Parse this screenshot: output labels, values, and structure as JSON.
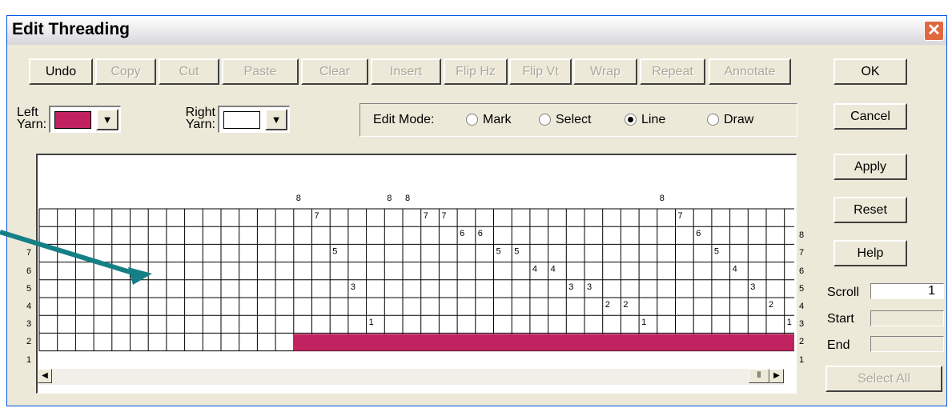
{
  "window": {
    "title": "Edit Threading",
    "close_glyph": "✕"
  },
  "toolbar": {
    "buttons": [
      {
        "label": "Undo",
        "enabled": true
      },
      {
        "label": "Copy",
        "enabled": false
      },
      {
        "label": "Cut",
        "enabled": false
      },
      {
        "label": "Paste",
        "enabled": false
      },
      {
        "label": "Clear",
        "enabled": false
      },
      {
        "label": "Insert",
        "enabled": false
      },
      {
        "label": "Flip Hz",
        "enabled": false
      },
      {
        "label": "Flip Vt",
        "enabled": false
      },
      {
        "label": "Wrap",
        "enabled": false
      },
      {
        "label": "Repeat",
        "enabled": false
      },
      {
        "label": "Annotate",
        "enabled": false
      }
    ]
  },
  "yarn": {
    "left_label_1": "Left",
    "left_label_2": "Yarn:",
    "left_color": "#c0235f",
    "right_label_1": "Right",
    "right_label_2": "Yarn:",
    "right_color": "#ffffff",
    "dropdown_glyph": "▼"
  },
  "edit_mode": {
    "label": "Edit Mode:",
    "options": [
      "Mark",
      "Select",
      "Line",
      "Draw"
    ],
    "selected": "Line"
  },
  "side_buttons": {
    "ok": "OK",
    "cancel": "Cancel",
    "apply": "Apply",
    "reset": "Reset",
    "help": "Help"
  },
  "scroll": {
    "scroll_label": "Scroll",
    "scroll_value": "1",
    "start_label": "Start",
    "start_value": "",
    "end_label": "End",
    "end_value": ""
  },
  "select_all": "Select All",
  "threading": {
    "shafts": 8,
    "columns": 42,
    "row_labels": [
      "8",
      "7",
      "6",
      "5",
      "4",
      "3",
      "2",
      "1"
    ],
    "marks": [
      {
        "col": 14,
        "shaft": 8
      },
      {
        "col": 15,
        "shaft": 7
      },
      {
        "col": 16,
        "shaft": 5
      },
      {
        "col": 17,
        "shaft": 3
      },
      {
        "col": 18,
        "shaft": 1
      },
      {
        "col": 19,
        "shaft": 8
      },
      {
        "col": 20,
        "shaft": 8
      },
      {
        "col": 21,
        "shaft": 7
      },
      {
        "col": 22,
        "shaft": 7
      },
      {
        "col": 23,
        "shaft": 6
      },
      {
        "col": 24,
        "shaft": 6
      },
      {
        "col": 25,
        "shaft": 5
      },
      {
        "col": 26,
        "shaft": 5
      },
      {
        "col": 27,
        "shaft": 4
      },
      {
        "col": 28,
        "shaft": 4
      },
      {
        "col": 29,
        "shaft": 3
      },
      {
        "col": 30,
        "shaft": 3
      },
      {
        "col": 31,
        "shaft": 2
      },
      {
        "col": 32,
        "shaft": 2
      },
      {
        "col": 33,
        "shaft": 1
      },
      {
        "col": 34,
        "shaft": 8
      },
      {
        "col": 35,
        "shaft": 7
      },
      {
        "col": 36,
        "shaft": 6
      },
      {
        "col": 37,
        "shaft": 5
      },
      {
        "col": 38,
        "shaft": 4
      },
      {
        "col": 39,
        "shaft": 3
      },
      {
        "col": 40,
        "shaft": 2
      },
      {
        "col": 41,
        "shaft": 1
      }
    ],
    "yarn_bar_start_col": 14,
    "yarn_bar_color": "#c0235f"
  },
  "hscroll": {
    "left_glyph": "◀",
    "right_glyph": "▶",
    "thumb_glyph": "⦀"
  },
  "annotation": {
    "arrow_color": "#157f86"
  }
}
